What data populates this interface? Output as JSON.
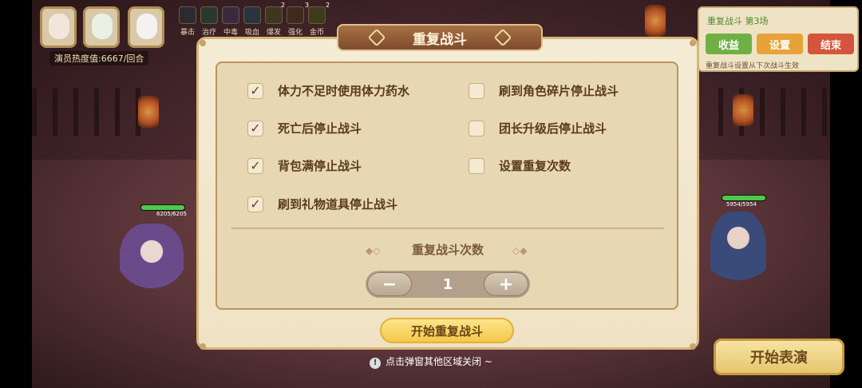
{
  "hud": {
    "skills": [
      "暴击",
      "治疗",
      "中毒",
      "吸血",
      "爆发",
      "强化",
      "金币"
    ],
    "skill_counts": [
      "2",
      "3",
      "2"
    ],
    "heat_label": "演员热度值:",
    "heat_value": "6667/回合"
  },
  "repeat_panel": {
    "title": "重复战斗 第3场",
    "buttons": [
      "收益",
      "设置",
      "结束"
    ],
    "note": "重复战斗设置从下次战斗生效"
  },
  "units": {
    "left_hp": "6205/6205",
    "right_hp": "5954/5954"
  },
  "dialog": {
    "title": "重复战斗",
    "options_left": [
      {
        "label": "体力不足时使用体力药水",
        "checked": true
      },
      {
        "label": "死亡后停止战斗",
        "checked": true
      },
      {
        "label": "背包满停止战斗",
        "checked": true
      },
      {
        "label": "刷到礼物道具停止战斗",
        "checked": true
      }
    ],
    "options_right": [
      {
        "label": "刷到角色碎片停止战斗",
        "checked": false
      },
      {
        "label": "团长升级后停止战斗",
        "checked": false
      },
      {
        "label": "设置重复次数",
        "checked": false
      }
    ],
    "count_title": "重复战斗次数",
    "count_value": "1",
    "minus": "−",
    "plus": "+",
    "start_label": "开始重复战斗"
  },
  "start_show_label": "开始表演",
  "hint": "点击弹窗其他区域关闭 ~",
  "check_glyph": "✓"
}
